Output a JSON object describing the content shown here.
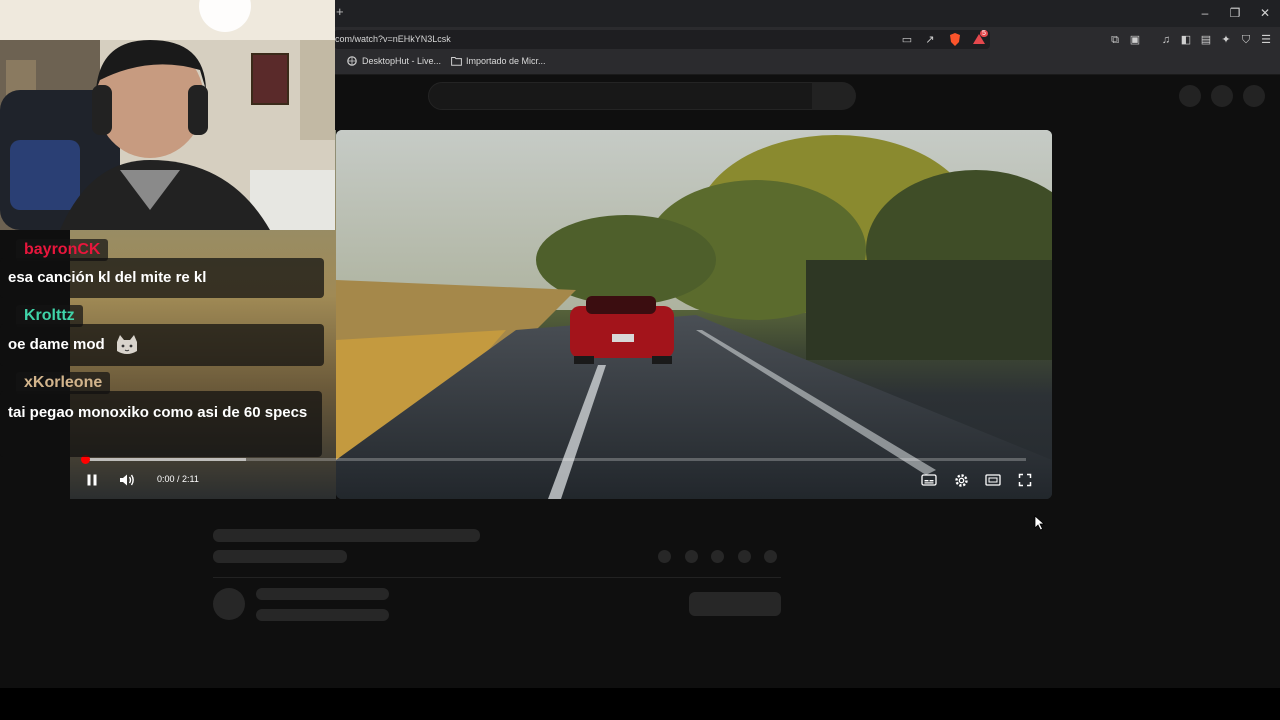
{
  "browser": {
    "new_tab_label": "+",
    "url": "com/watch?v=nEHkYN3Lcsk",
    "window_controls": {
      "minimize": "–",
      "restore": "❐",
      "close": "✕"
    },
    "shield_count": "5",
    "bookmarks": [
      {
        "label": "DesktopHut - Live...",
        "icon": "globe-icon"
      },
      {
        "label": "Importado de Micr...",
        "icon": "folder-icon"
      }
    ]
  },
  "player": {
    "time": "0:00 / 2:11",
    "progress_fraction": 0.0,
    "buffered_fraction": 0.17,
    "accent_color": "#ff0000",
    "controls": [
      "pause-icon",
      "volume-icon",
      "subtitles-icon",
      "settings-gear-icon",
      "theater-mode-icon",
      "fullscreen-icon"
    ]
  },
  "chat": [
    {
      "user": "bayronCK",
      "color": "#e8163c",
      "message": "esa canción kl del mite re kl"
    },
    {
      "user": "Krolttz",
      "color": "#3fd3a8",
      "message": "oe dame mod",
      "emote": "cat-emote"
    },
    {
      "user": "xKorleone",
      "color": "#d2b48c",
      "message": "tai pegao monoxiko como asi de 60 specs"
    }
  ]
}
